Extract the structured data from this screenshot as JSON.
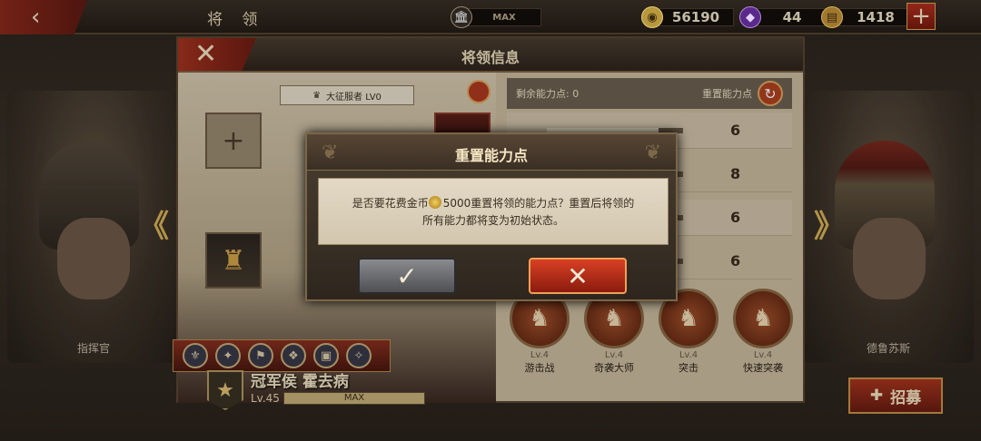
{
  "topbar": {
    "back_icon": "‹",
    "title": "将 领",
    "treasury_label": "MAX",
    "coins": "56190",
    "gems": "44",
    "supplies": "1418",
    "plus_icon": "+"
  },
  "side": {
    "left_label": "指挥官",
    "right_label": "德鲁苏斯"
  },
  "panel": {
    "title": "将领信息",
    "close_icon": "✕",
    "rank_icon": "♛",
    "rank_label": "大征服者 LV0",
    "add_slot_icon": "+",
    "general_name": "冠军侯 霍去病",
    "level": "Lv.45",
    "xp_label": "MAX",
    "remaining_points": "剩余能力点: 0",
    "reset_label": "重置能力点",
    "stats": [
      {
        "value": "6",
        "fill": 0.82
      },
      {
        "value": "8",
        "fill": 0.9
      },
      {
        "value": "6",
        "fill": 0.82
      },
      {
        "value": "6",
        "fill": 0.82
      }
    ],
    "skills": [
      {
        "lv": "Lv.4",
        "name": "游击战"
      },
      {
        "lv": "Lv.4",
        "name": "奇袭大师"
      },
      {
        "lv": "Lv.4",
        "name": "突击"
      },
      {
        "lv": "Lv.4",
        "name": "快速突袭"
      }
    ]
  },
  "recruit_label": "招募",
  "dialog": {
    "title": "重置能力点",
    "line1_pre": "是否要花费金币",
    "line1_post": "5000重置将领的能力点？重置后将领的",
    "line2": "所有能力都将变为初始状态。",
    "ok_icon": "✓",
    "cancel_icon": "✕"
  }
}
